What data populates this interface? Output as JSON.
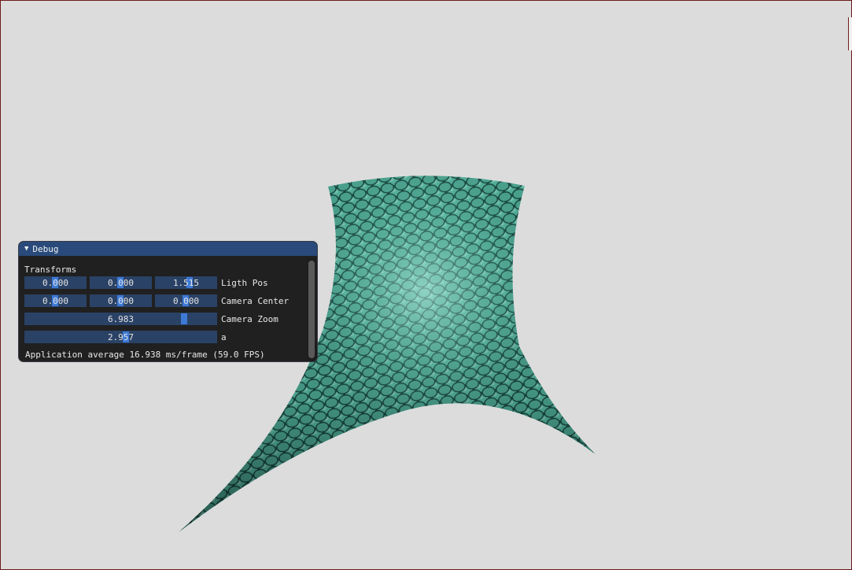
{
  "window": {
    "frame_color": "#6e1a1a",
    "background_color": "#dcdcdc"
  },
  "scene": {
    "object": "textured-surface",
    "texture": "reptile-scale-leather",
    "texture_color": "#3fa592",
    "texture_highlight": "#a8eddc",
    "texture_shadow": "#0f3530"
  },
  "debug": {
    "title": "Debug",
    "collapse_icon": "triangle-down-icon",
    "section": "Transforms",
    "controls": {
      "light_pos": {
        "label": "Ligth Pos",
        "values": [
          "0.000",
          "0.000",
          "1.515"
        ]
      },
      "camera_center": {
        "label": "Camera Center",
        "values": [
          "0.000",
          "0.000",
          "0.000"
        ]
      },
      "camera_zoom": {
        "label": "Camera Zoom",
        "value": "6.983"
      },
      "a": {
        "label": "a",
        "value": "2.957"
      }
    },
    "status": "Application average 16.938 ms/frame (59.0 FPS)",
    "colors": {
      "title_bar": "#294a7a",
      "field_bg": "#2a4266",
      "grab": "#3d7ad6",
      "panel_bg": "#141414"
    }
  }
}
